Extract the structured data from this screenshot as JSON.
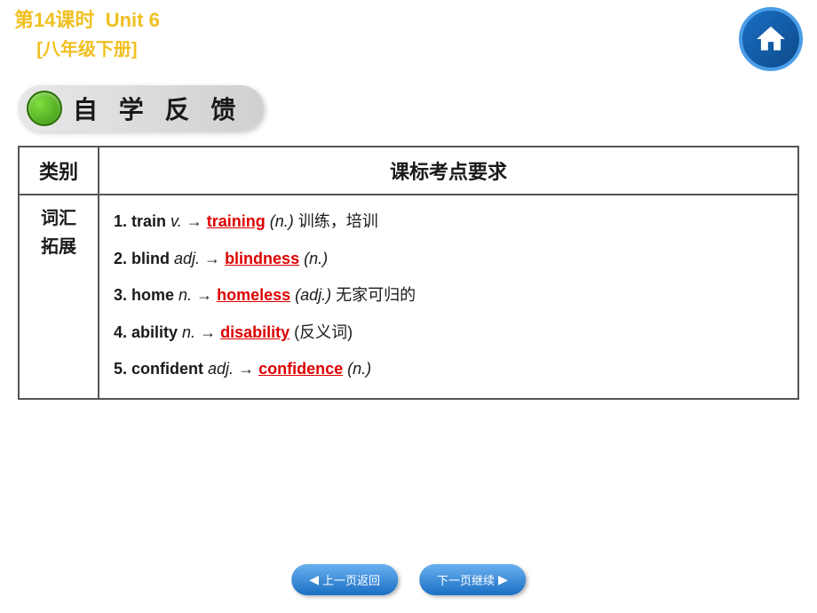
{
  "header": {
    "lesson": "第14课时",
    "unit": "Unit 6",
    "grade": "[八年级下册]"
  },
  "banner": {
    "text": "自 学 反 馈"
  },
  "table": {
    "col1_header": "类别",
    "col2_header": "课标考点要求",
    "category": "词汇\n拓展",
    "items": [
      {
        "num": "1.",
        "base": "train",
        "pos1": "v.",
        "arrow": "→",
        "answer": "training",
        "pos2": "(n.)",
        "note": "训练，培训"
      },
      {
        "num": "2.",
        "base": "blind",
        "pos1": "adj.",
        "arrow": "→",
        "answer": "blindness",
        "pos2": "(n.)",
        "note": ""
      },
      {
        "num": "3.",
        "base": "home",
        "pos1": "n.",
        "arrow": "→",
        "answer": "homeless",
        "pos2": "(adj.)",
        "note": "无家可归的"
      },
      {
        "num": "4.",
        "base": "ability",
        "pos1": "n.",
        "arrow": "→",
        "answer": "disability",
        "pos2": "(反义词)",
        "note": ""
      },
      {
        "num": "5.",
        "base": "confident",
        "pos1": "adj.",
        "arrow": "→",
        "answer": "confidence",
        "pos2": "(n.)",
        "note": ""
      }
    ]
  },
  "bottom_nav": {
    "prev_label": "上一页返回",
    "next_label": "下一页继续"
  }
}
